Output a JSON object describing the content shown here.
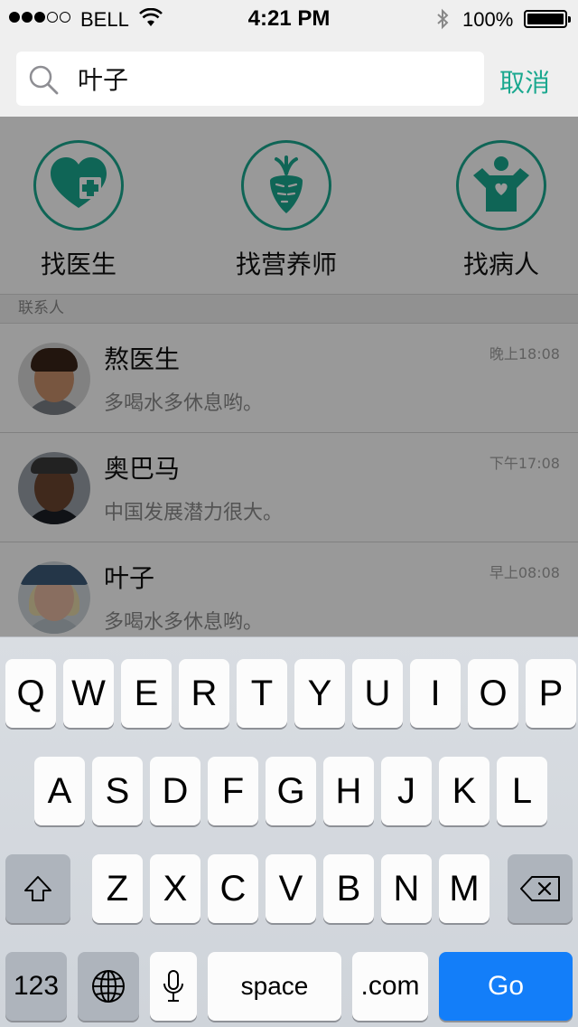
{
  "status_bar": {
    "carrier": "BELL",
    "time": "4:21 PM",
    "battery": "100%",
    "icons": [
      "signal-dots",
      "wifi-icon",
      "bluetooth-icon",
      "battery-icon"
    ]
  },
  "search": {
    "value": "叶子",
    "cancel_label": "取消"
  },
  "quick_actions": [
    {
      "label": "找医生",
      "icon": "heart-plus-icon"
    },
    {
      "label": "找营养师",
      "icon": "carrot-icon"
    },
    {
      "label": "找病人",
      "icon": "person-heart-icon"
    }
  ],
  "section": {
    "title": "联系人"
  },
  "contacts": [
    {
      "name": "熬医生",
      "message": "多喝水多休息哟。",
      "time": "晚上18:08",
      "avatar": "avatar-man"
    },
    {
      "name": "奥巴马",
      "message": "中国发展潜力很大。",
      "time": "下午17:08",
      "avatar": "avatar-man-suit"
    },
    {
      "name": "叶子",
      "message": "多喝水多休息哟。",
      "time": "早上08:08",
      "avatar": "avatar-woman-hat"
    }
  ],
  "keyboard": {
    "row1": [
      "Q",
      "W",
      "E",
      "R",
      "T",
      "Y",
      "U",
      "I",
      "O",
      "P"
    ],
    "row2": [
      "A",
      "S",
      "D",
      "F",
      "G",
      "H",
      "J",
      "K",
      "L"
    ],
    "row3": [
      "Z",
      "X",
      "C",
      "V",
      "B",
      "N",
      "M"
    ],
    "numbers_label": "123",
    "space_label": "space",
    "dotcom_label": ".com",
    "go_label": "Go"
  },
  "colors": {
    "accent": "#1aa88f",
    "go_key": "#137ef9",
    "overlay": "rgba(0,0,0,0.40)"
  }
}
